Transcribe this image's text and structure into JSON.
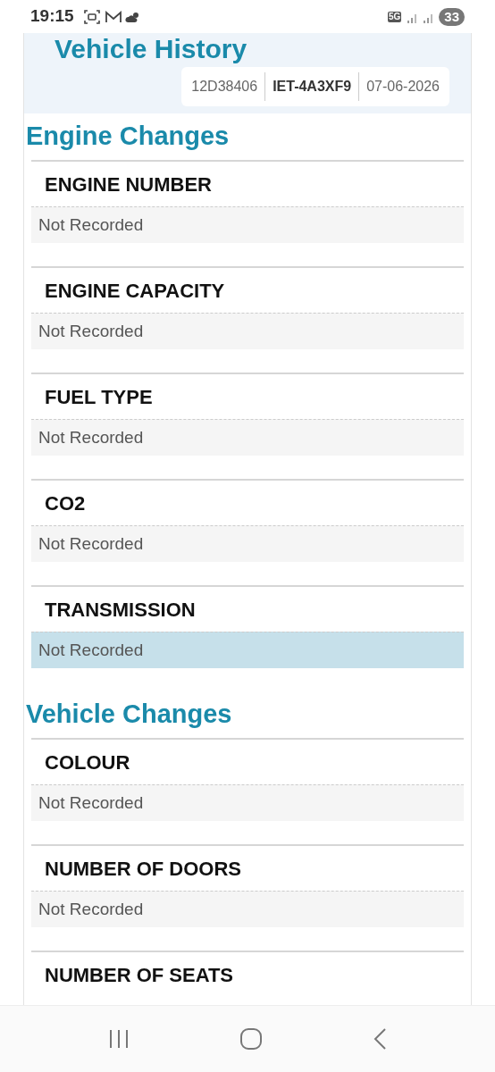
{
  "status_bar": {
    "time": "19:15",
    "network": "5G",
    "battery": "33"
  },
  "page_title": "Vehicle History",
  "chips": [
    {
      "text": "12D38406",
      "bold": false
    },
    {
      "text": "IET-4A3XF9",
      "bold": true
    },
    {
      "text": "07-06-2026",
      "bold": false
    }
  ],
  "sections": [
    {
      "title": "Engine Changes",
      "fields": [
        {
          "label": "ENGINE NUMBER",
          "value": "Not Recorded",
          "highlighted": false
        },
        {
          "label": "ENGINE CAPACITY",
          "value": "Not Recorded",
          "highlighted": false
        },
        {
          "label": "FUEL TYPE",
          "value": "Not Recorded",
          "highlighted": false
        },
        {
          "label": "CO2",
          "value": "Not Recorded",
          "highlighted": false
        },
        {
          "label": "TRANSMISSION",
          "value": "Not Recorded",
          "highlighted": true
        }
      ]
    },
    {
      "title": "Vehicle Changes",
      "fields": [
        {
          "label": "COLOUR",
          "value": "Not Recorded",
          "highlighted": false
        },
        {
          "label": "NUMBER OF DOORS",
          "value": "Not Recorded",
          "highlighted": false
        },
        {
          "label": "NUMBER OF SEATS"
        }
      ]
    }
  ]
}
